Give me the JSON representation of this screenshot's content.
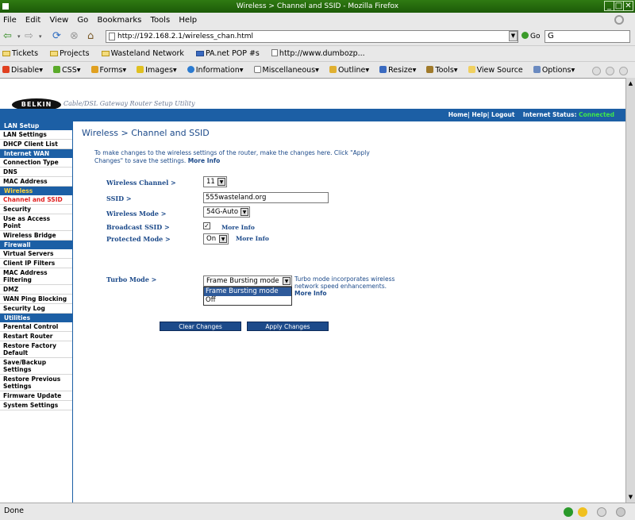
{
  "window": {
    "title": "Wireless > Channel and SSID - Mozilla Firefox"
  },
  "menu": [
    "File",
    "Edit",
    "View",
    "Go",
    "Bookmarks",
    "Tools",
    "Help"
  ],
  "nav": {
    "url": "http://192.168.2.1/wireless_chan.html",
    "go_label": "Go",
    "search_value": "G"
  },
  "bookmarks": [
    "Tickets",
    "Projects",
    "Wasteland Network",
    "PA.net POP #s",
    "http://www.dumbozp..."
  ],
  "devtoolbar": [
    "Disable▾",
    "CSS▾",
    "Forms▾",
    "Images▾",
    "Information▾",
    "Miscellaneous▾",
    "Outline▾",
    "Resize▾",
    "Tools▾",
    "View Source",
    "Options▾"
  ],
  "header": {
    "logo": "BELKIN",
    "tagline": "Cable/DSL Gateway Router Setup Utility",
    "links": "Home| Help| Logout",
    "status_label": "Internet Status:",
    "status_value": "Connected"
  },
  "sidebar": {
    "lan_header": "LAN Setup",
    "lan_items": [
      "LAN Settings",
      "DHCP Client List"
    ],
    "wan_header": "Internet WAN",
    "wan_items": [
      "Connection Type",
      "DNS",
      "MAC Address"
    ],
    "wireless_header": "Wireless",
    "wireless_items": [
      "Channel and SSID",
      "Security",
      "Use as Access Point",
      "Wireless Bridge"
    ],
    "firewall_header": "Firewall",
    "firewall_items": [
      "Virtual Servers",
      "Client IP Filters",
      "MAC Address Filtering",
      "DMZ",
      "WAN Ping Blocking",
      "Security Log"
    ],
    "utilities_header": "Utilities",
    "utilities_items": [
      "Parental Control",
      "Restart Router",
      "Restore Factory Default",
      "Save/Backup Settings",
      "Restore Previous Settings",
      "Firmware Update",
      "System Settings"
    ]
  },
  "main": {
    "title": "Wireless > Channel and SSID",
    "intro": "To make changes to the wireless settings of the router, make the changes here. Click \"Apply Changes\" to save the settings.",
    "intro_link": "More Info",
    "channel_label": "Wireless Channel >",
    "channel_value": "11",
    "ssid_label": "SSID >",
    "ssid_value": "555wasteland.org",
    "mode_label": "Wireless Mode >",
    "mode_value": "54G-Auto",
    "broadcast_label": "Broadcast SSID >",
    "broadcast_checked": "✓",
    "broadcast_more": "More Info",
    "protected_label": "Protected Mode >",
    "protected_value": "On",
    "protected_more": "More Info",
    "turbo_label": "Turbo Mode >",
    "turbo_value": "Frame Bursting mode",
    "turbo_options": [
      "Frame Bursting mode",
      "Off"
    ],
    "turbo_desc": "Turbo mode incorporates wireless network speed enhancements.",
    "turbo_more": "More Info",
    "clear_label": "Clear Changes",
    "apply_label": "Apply Changes"
  },
  "status": {
    "text": "Done"
  }
}
